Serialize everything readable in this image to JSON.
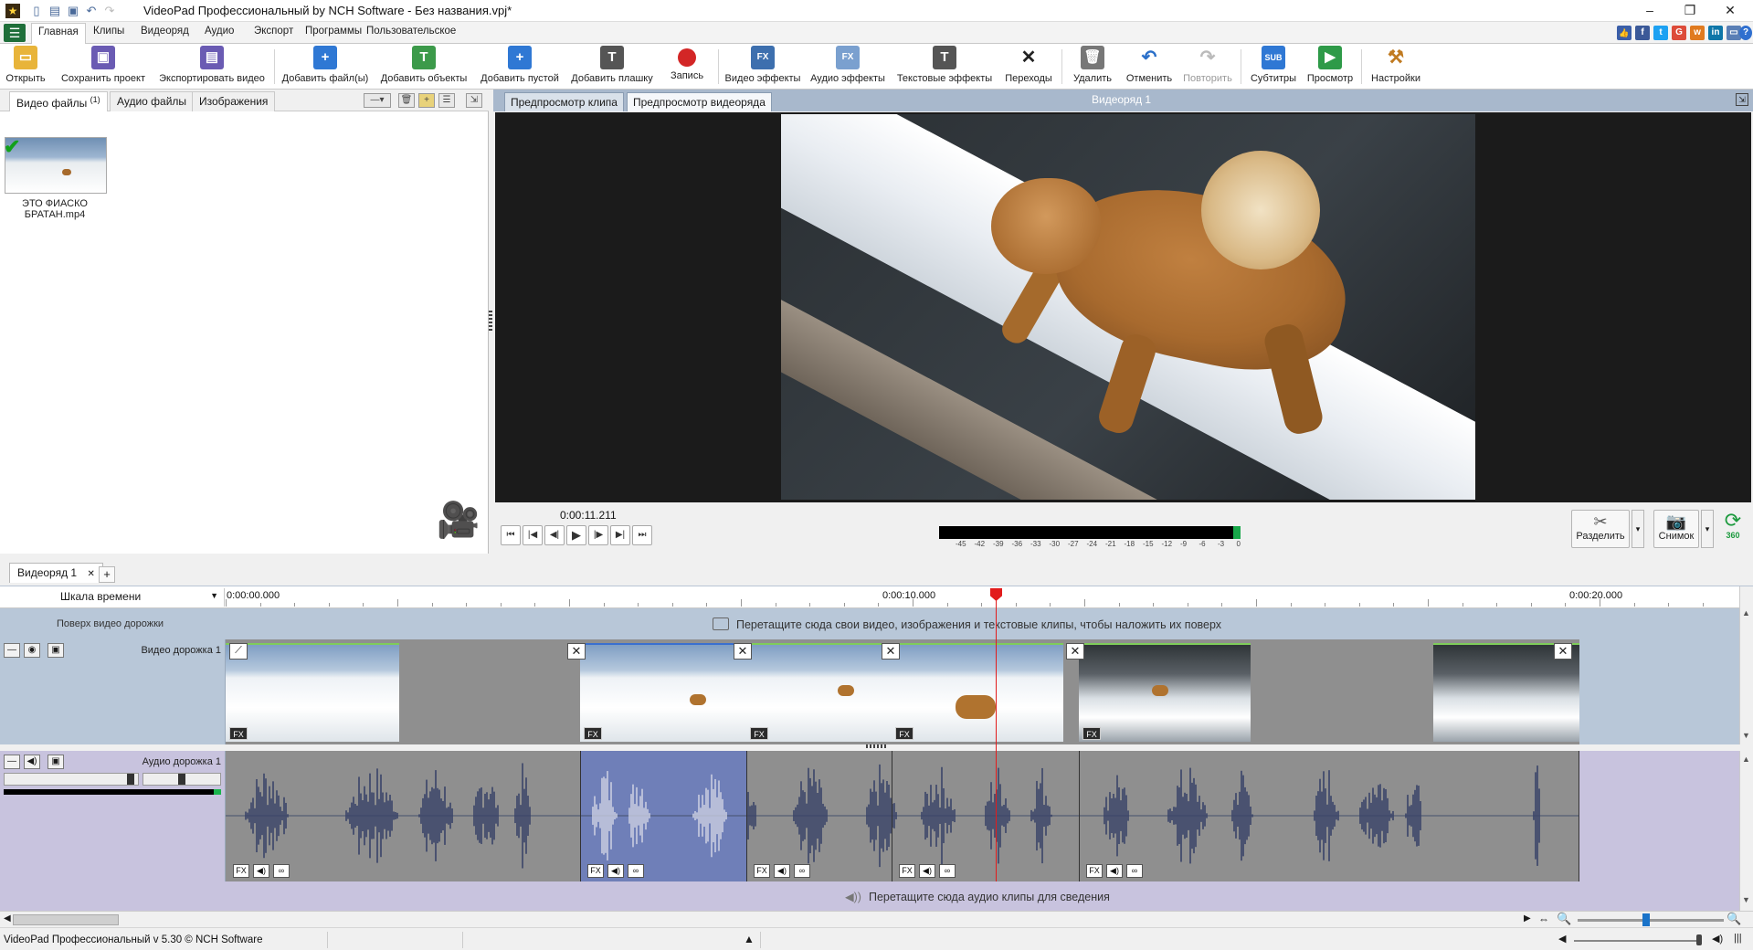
{
  "window": {
    "title": "VideoPad Профессиональный by NCH Software - Без названия.vpj*",
    "controls": {
      "minimize": "–",
      "restore": "❐",
      "close": "✕"
    }
  },
  "menu": {
    "tabs": [
      "Главная",
      "Клипы",
      "Видеоряд",
      "Аудио",
      "Экспорт",
      "Программы",
      "Пользовательское"
    ],
    "active": "Главная",
    "social": [
      "f",
      "t",
      "G",
      "w",
      "in",
      "▭",
      "?"
    ]
  },
  "toolbar": {
    "buttons": [
      {
        "label": "Открыть",
        "icon": "folder-icon"
      },
      {
        "label": "Сохранить проект",
        "icon": "save-icon"
      },
      {
        "label": "Экспортировать видео",
        "icon": "export-icon"
      },
      {
        "label": "Добавить файл(ы)",
        "icon": "add-file-icon"
      },
      {
        "label": "Добавить объекты",
        "icon": "add-objects-icon"
      },
      {
        "label": "Добавить пустой",
        "icon": "add-blank-icon"
      },
      {
        "label": "Добавить плашку",
        "icon": "add-title-icon"
      },
      {
        "label": "Запись",
        "icon": "record-icon"
      },
      {
        "label": "Видео эффекты",
        "icon": "video-fx-icon"
      },
      {
        "label": "Аудио эффекты",
        "icon": "audio-fx-icon"
      },
      {
        "label": "Текстовые эффекты",
        "icon": "text-fx-icon"
      },
      {
        "label": "Переходы",
        "icon": "transition-icon"
      },
      {
        "label": "Удалить",
        "icon": "trash-icon"
      },
      {
        "label": "Отменить",
        "icon": "undo-icon"
      },
      {
        "label": "Повторить",
        "icon": "redo-icon"
      },
      {
        "label": "Субтитры",
        "icon": "subtitles-icon"
      },
      {
        "label": "Просмотр",
        "icon": "preview-icon"
      },
      {
        "label": "Настройки",
        "icon": "settings-icon"
      }
    ],
    "icon_text": {
      "fx": "FX",
      "sub": "SUB"
    }
  },
  "bin": {
    "tabs": [
      {
        "label": "Видео файлы",
        "count": "(1)"
      },
      {
        "label": "Аудио файлы"
      },
      {
        "label": "Изображения"
      }
    ],
    "file": {
      "name_line1": "ЭТО ФИАСКО",
      "name_line2": "БРАТАН.mp4",
      "check": "✔"
    }
  },
  "preview": {
    "tabs": [
      "Предпросмотр клипа",
      "Предпросмотр видеоряда"
    ],
    "active_tab": "Предпросмотр видеоряда",
    "sequence_title": "Видеоряд 1",
    "timecode": "0:00:11.211",
    "meter_labels": [
      "-45",
      "-42",
      "-39",
      "-36",
      "-33",
      "-30",
      "-27",
      "-24",
      "-21",
      "-18",
      "-15",
      "-12",
      "-9",
      "-6",
      "-3",
      "0"
    ],
    "split_label": "Разделить",
    "snapshot_label": "Снимок",
    "rotate_label": "360"
  },
  "sequence": {
    "tab_label": "Видеоряд 1",
    "tab_close": "✕",
    "add_tab": "+"
  },
  "timeline": {
    "scale_label": "Шкала времени",
    "ticks": [
      "0:00:00.000",
      "0:00:10.000",
      "0:00:20.000"
    ],
    "overlay_label": "Поверх видео дорожки",
    "overlay_hint": "Перетащите сюда свои видео, изображения и текстовые клипы, чтобы наложить их поверх",
    "video_track_label": "Видео дорожка 1",
    "audio_track_label": "Аудио дорожка 1",
    "audio_hint": "Перетащите сюда аудио клипы для сведения",
    "fx": "FX",
    "transition_glyph": "✕"
  },
  "status": {
    "text": "VideoPad Профессиональный v 5.30 © NCH Software"
  }
}
